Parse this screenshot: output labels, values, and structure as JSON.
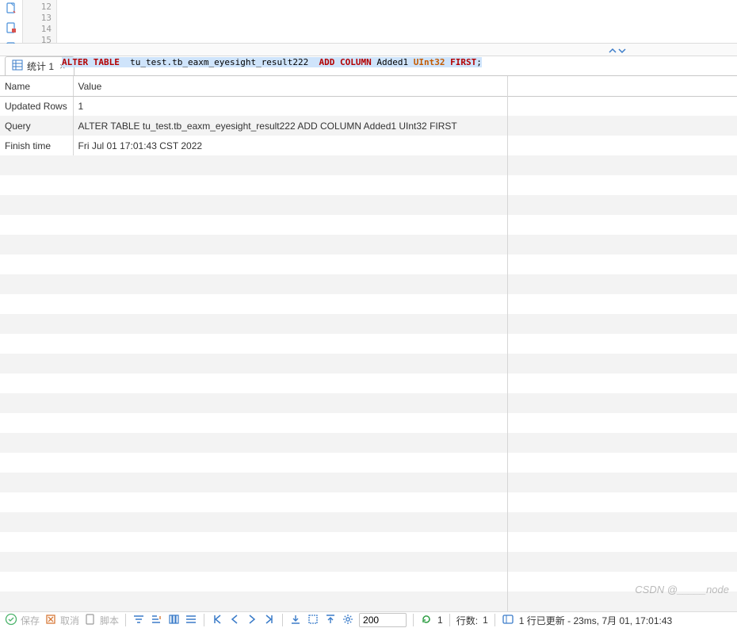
{
  "editor": {
    "line_numbers": [
      "12",
      "13",
      "14",
      "15"
    ],
    "sql": {
      "kw1": "ALTER",
      "kw2": "TABLE",
      "obj": "tu_test.tb_eaxm_eyesight_result222",
      "kw3": "ADD",
      "kw4": "COLUMN",
      "col": "Added1",
      "type": "UInt32",
      "kw5": "FIRST",
      "semi": ";"
    }
  },
  "tab": {
    "label": "统计 1",
    "close": "×"
  },
  "grid": {
    "columns": {
      "name": "Name",
      "value": "Value"
    },
    "rows": [
      {
        "name": "Updated Rows",
        "value": "1"
      },
      {
        "name": "Query",
        "value": "ALTER TABLE  tu_test.tb_eaxm_eyesight_result222  ADD COLUMN Added1 UInt32 FIRST"
      },
      {
        "name": "Finish time",
        "value": "Fri Jul 01 17:01:43 CST 2022"
      }
    ]
  },
  "status": {
    "save": "保存",
    "cancel": "取消",
    "script": "脚本",
    "fetch_size": "200",
    "refresh_count": "1",
    "rows_label": "行数:",
    "rows_value": "1",
    "message": "1 行已更新 - 23ms, 7月 01, 17:01:43"
  },
  "watermark": "CSDN @_____node"
}
